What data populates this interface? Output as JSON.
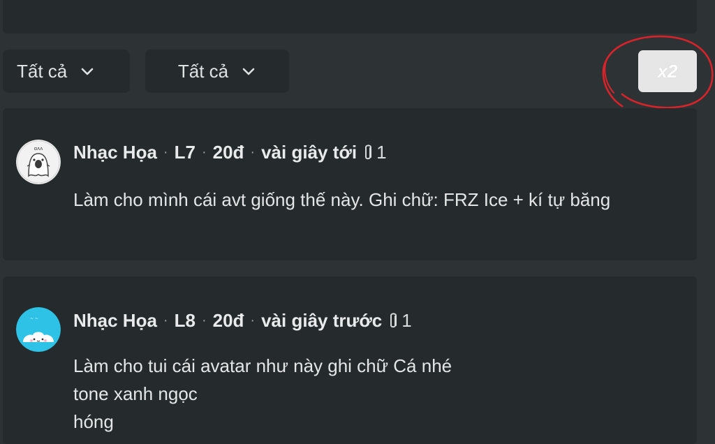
{
  "filters": [
    {
      "label": "Tất cả"
    },
    {
      "label": "Tất cả"
    }
  ],
  "x2_button": {
    "label": "x2"
  },
  "colors": {
    "background": "#2d3335",
    "card": "#252a2c",
    "accent_bar": "#e0b326",
    "annotation": "#d9232a"
  },
  "posts": [
    {
      "author": "Nhạc Họa",
      "level": "L7",
      "points": "20đ",
      "time": "vài giây tới",
      "attachments": "1",
      "avatar_icon": "ghost-sticker-avatar",
      "lines": [
        "Làm cho mình cái avt giống thế này. Ghi chữ: FRZ Ice + kí tự băng"
      ]
    },
    {
      "author": "Nhạc Họa",
      "level": "L8",
      "points": "20đ",
      "time": "vài giây trước",
      "attachments": "1",
      "avatar_icon": "cyan-cloud-avatar",
      "lines": [
        "Làm cho tui cái avatar như này ghi chữ Cá nhé",
        "tone xanh ngọc",
        "hóng"
      ]
    }
  ]
}
